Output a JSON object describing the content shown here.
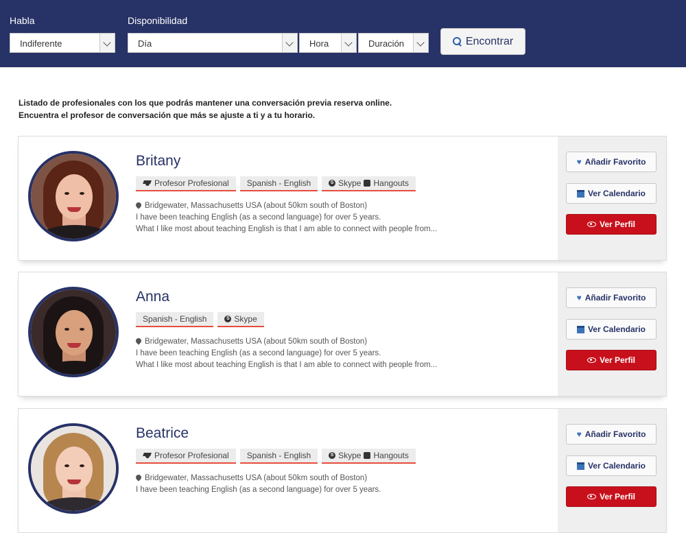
{
  "search": {
    "language_label": "Habla",
    "availability_label": "Disponibilidad",
    "language_value": "Indiferente",
    "day_value": "Día",
    "hour_value": "Hora",
    "duration_value": "Duración",
    "find_button": "Encontrar"
  },
  "intro": {
    "line1": "Listado de profesionales con los que podrás mantener una conversación previa reserva online.",
    "line2": "Encuentra el profesor de conversación que más se ajuste a ti y a tu horario."
  },
  "actions": {
    "favorite": "Añadir Favorito",
    "calendar": "Ver Calendario",
    "profile": "Ver Perfil"
  },
  "teachers": [
    {
      "name": "Britany",
      "tag_pro": "Profesor Profesional",
      "tag_lang": "Spanish - English",
      "tag_skype": "Skype",
      "tag_hangouts": "Hangouts",
      "location": "Bridgewater, Massachusetts USA (about 50km south of Boston)",
      "line1": "I have been teaching English (as a second language) for over 5 years.",
      "line2": "What I like most about teaching English is that I am able to connect with people from..."
    },
    {
      "name": "Anna",
      "tag_lang": "Spanish - English",
      "tag_skype": "Skype",
      "location": "Bridgewater, Massachusetts USA (about 50km south of Boston)",
      "line1": "I have been teaching English (as a second language) for over 5 years.",
      "line2": "What I like most about teaching English is that I am able to connect with people from..."
    },
    {
      "name": "Beatrice",
      "tag_pro": "Profesor Profesional",
      "tag_lang": "Spanish - English",
      "tag_skype": "Skype",
      "tag_hangouts": "Hangouts",
      "location": "Bridgewater, Massachusetts USA (about 50km south of Boston)",
      "line1": "I have been teaching English (as a second language) for over 5 years."
    }
  ],
  "colors": {
    "navy": "#273266",
    "red": "#c8101c",
    "tag_underline": "#e74c3c"
  }
}
